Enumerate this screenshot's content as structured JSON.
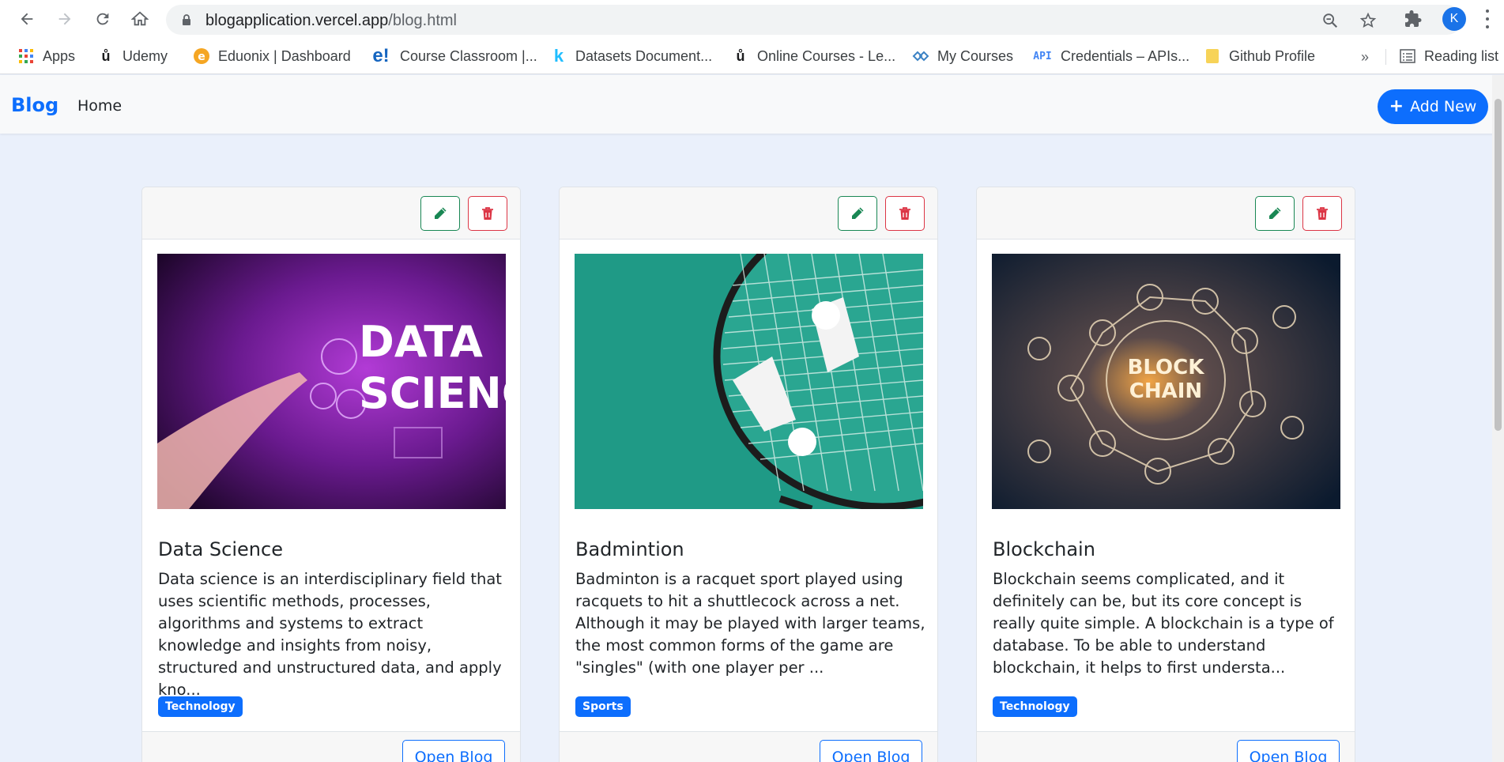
{
  "browser": {
    "url_host": "blogapplication.vercel.app",
    "url_path": "/blog.html",
    "profile_initial": "K"
  },
  "bookmarks": {
    "items": [
      {
        "label": "Apps",
        "icon": "apps-grid-icon"
      },
      {
        "label": "Udemy",
        "icon": "udemy-icon"
      },
      {
        "label": "Eduonix | Dashboard",
        "icon": "eduonix-icon"
      },
      {
        "label": "Course Classroom |...",
        "icon": "e-logo-icon"
      },
      {
        "label": "Datasets Document...",
        "icon": "kaggle-icon"
      },
      {
        "label": "Online Courses - Le...",
        "icon": "udemy-icon"
      },
      {
        "label": "My Courses",
        "icon": "courses-icon"
      },
      {
        "label": "Credentials – APIs...",
        "icon": "api-icon"
      },
      {
        "label": "Github Profile",
        "icon": "folder-icon"
      }
    ],
    "more": "»",
    "reading_list": "Reading list"
  },
  "navbar": {
    "brand": "Blog",
    "home": "Home",
    "add_new": "Add New"
  },
  "cards": [
    {
      "title": "Data Science",
      "text": "Data science is an interdisciplinary field that uses scientific methods, processes, algorithms and systems to extract knowledge and insights from noisy, structured and unstructured data, and apply kno...",
      "badge": "Technology",
      "image_text_1": "DATA",
      "image_text_2": "SCIENCE",
      "open": "Open Blog"
    },
    {
      "title": "Badmintion",
      "text": "Badminton is a racquet sport played using racquets to hit a shuttlecock across a net. Although it may be played with larger teams, the most common forms of the game are \"singles\" (with one player per ...",
      "badge": "Sports",
      "open": "Open Blog"
    },
    {
      "title": "Blockchain",
      "text": "Blockchain seems complicated, and it definitely can be, but its core concept is really quite simple. A blockchain is a type of database. To be able to understand blockchain, it helps to first understa...",
      "badge": "Technology",
      "image_text_1": "BLOCK",
      "image_text_2": "CHAIN",
      "open": "Open Blog"
    }
  ],
  "colors": {
    "primary": "#0d6efd",
    "success": "#198754",
    "danger": "#dc3545",
    "page_bg": "#eaf0fb"
  }
}
